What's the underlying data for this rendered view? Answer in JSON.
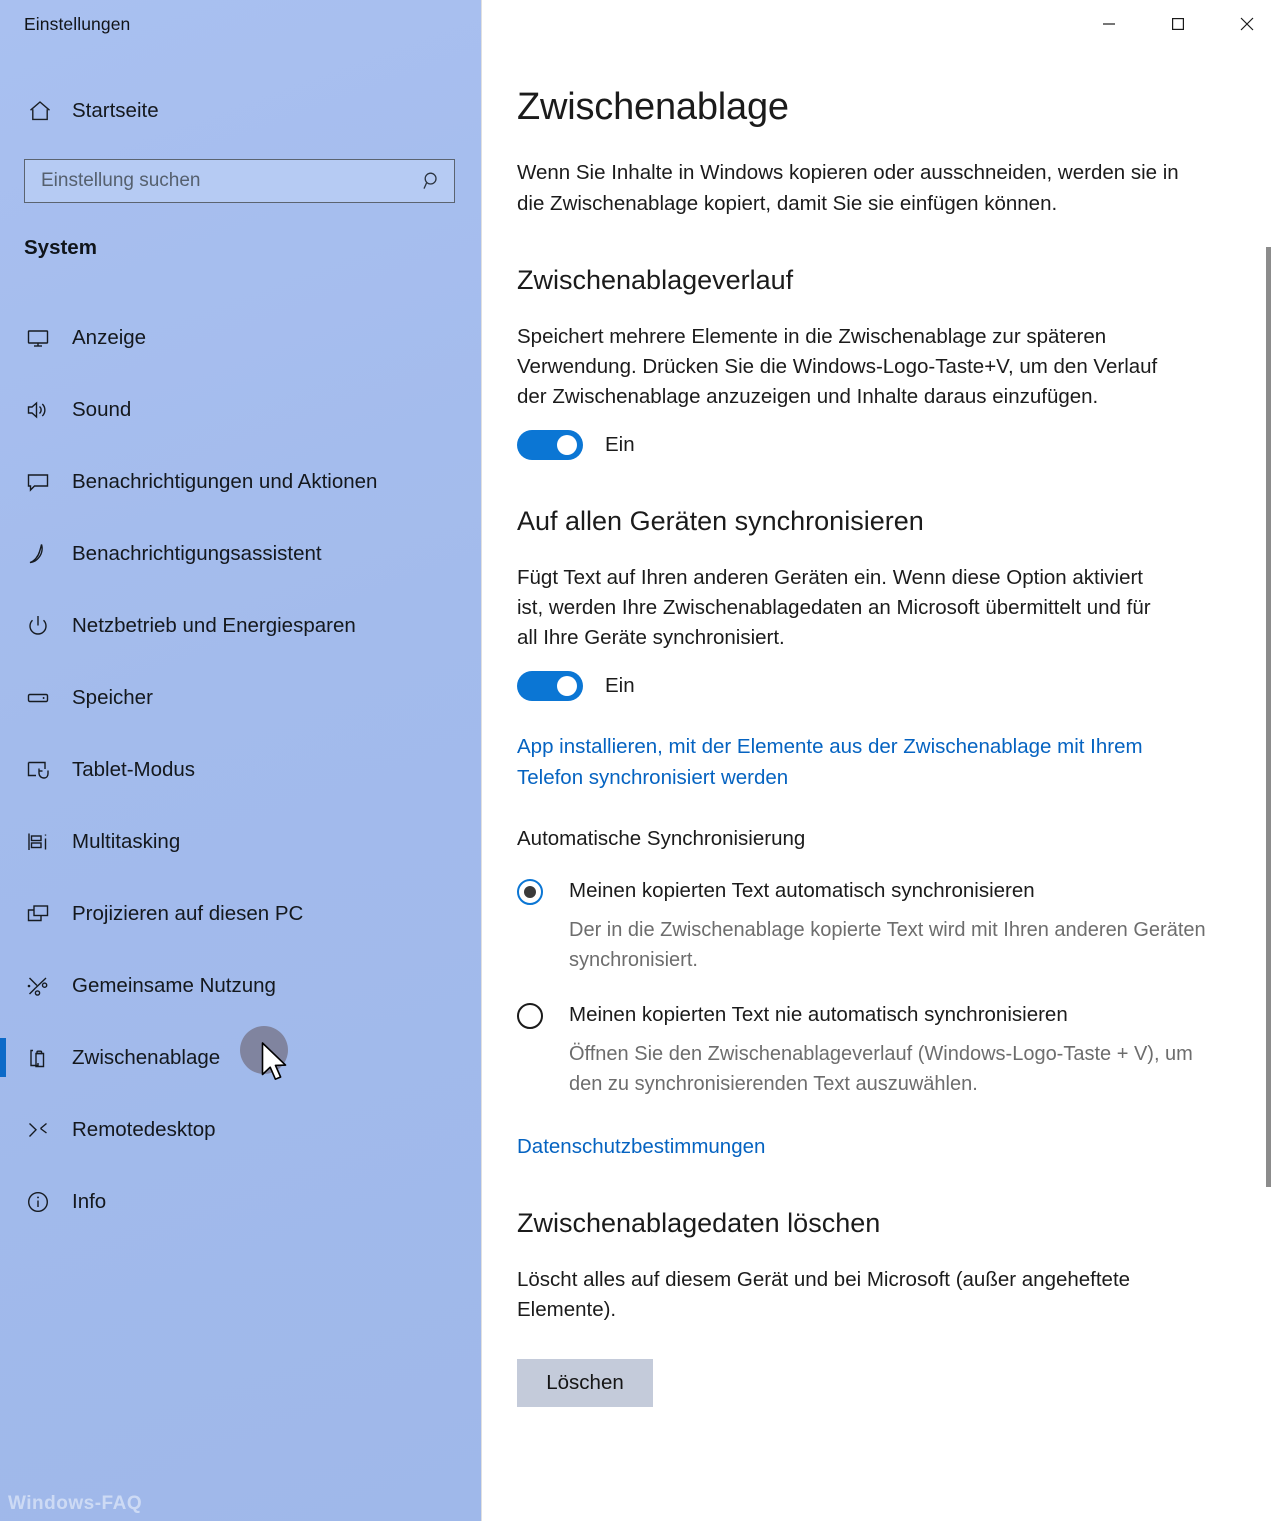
{
  "window": {
    "app_title": "Einstellungen",
    "controls": {
      "minimize": "minimize-icon",
      "maximize": "maximize-icon",
      "close": "close-icon"
    }
  },
  "sidebar": {
    "home": {
      "label": "Startseite",
      "icon": "home-icon"
    },
    "search": {
      "placeholder": "Einstellung suchen",
      "value": "",
      "icon": "search-icon"
    },
    "group_title": "System",
    "items": [
      {
        "label": "Anzeige",
        "icon": "monitor-icon",
        "selected": false
      },
      {
        "label": "Sound",
        "icon": "speaker-icon",
        "selected": false
      },
      {
        "label": "Benachrichtigungen und Aktionen",
        "icon": "chat-bubble-icon",
        "selected": false
      },
      {
        "label": "Benachrichtigungsassistent",
        "icon": "moon-icon",
        "selected": false
      },
      {
        "label": "Netzbetrieb und Energiesparen",
        "icon": "power-icon",
        "selected": false
      },
      {
        "label": "Speicher",
        "icon": "drive-icon",
        "selected": false
      },
      {
        "label": "Tablet-Modus",
        "icon": "tablet-touch-icon",
        "selected": false
      },
      {
        "label": "Multitasking",
        "icon": "multitasking-icon",
        "selected": false
      },
      {
        "label": "Projizieren auf diesen PC",
        "icon": "project-screen-icon",
        "selected": false
      },
      {
        "label": "Gemeinsame Nutzung",
        "icon": "share-nodes-icon",
        "selected": false
      },
      {
        "label": "Zwischenablage",
        "icon": "clipboard-icon",
        "selected": true
      },
      {
        "label": "Remotedesktop",
        "icon": "remote-desktop-icon",
        "selected": false
      },
      {
        "label": "Info",
        "icon": "info-circle-icon",
        "selected": false
      }
    ],
    "watermark": "Windows-FAQ"
  },
  "main": {
    "page_title": "Zwischenablage",
    "page_description": "Wenn Sie Inhalte in Windows kopieren oder ausschneiden, werden sie in die Zwischenablage kopiert, damit Sie sie einfügen können.",
    "history": {
      "title": "Zwischenablageverlauf",
      "description": "Speichert mehrere Elemente in die Zwischenablage zur späteren Verwendung. Drücken Sie die Windows-Logo-Taste+V, um den Verlauf der Zwischenablage anzuzeigen und Inhalte daraus einzufügen.",
      "toggle_state": "Ein"
    },
    "sync": {
      "title": "Auf allen Geräten synchronisieren",
      "description": "Fügt Text auf Ihren anderen Geräten ein. Wenn diese Option aktiviert ist, werden Ihre Zwischenablagedaten an Microsoft übermittelt und für all Ihre Geräte synchronisiert.",
      "toggle_state": "Ein",
      "install_link": "App installieren, mit der Elemente aus der Zwischenablage mit Ihrem Telefon synchronisiert werden",
      "auto_sync_heading": "Automatische Synchronisierung",
      "options": [
        {
          "label": "Meinen kopierten Text automatisch synchronisieren",
          "help": "Der in die Zwischenablage kopierte Text wird mit Ihren anderen Geräten synchronisiert.",
          "selected": true
        },
        {
          "label": "Meinen kopierten Text nie automatisch synchronisieren",
          "help": "Öffnen Sie den Zwischenablageverlauf (Windows-Logo-Taste + V), um den zu synchronisierenden Text auszuwählen.",
          "selected": false
        }
      ],
      "privacy_link": "Datenschutzbestimmungen"
    },
    "clear": {
      "title": "Zwischenablagedaten löschen",
      "description": "Löscht alles auf diesem Gerät und bei Microsoft (außer angeheftete Elemente).",
      "button_label": "Löschen"
    }
  },
  "colors": {
    "sidebar_bg": "#a6bdee",
    "accent": "#0b76d4",
    "selected_bar": "#0c6ac8",
    "link": "#0563c1",
    "button_bg": "#c4cbda",
    "help_text": "#6d6d6d"
  }
}
